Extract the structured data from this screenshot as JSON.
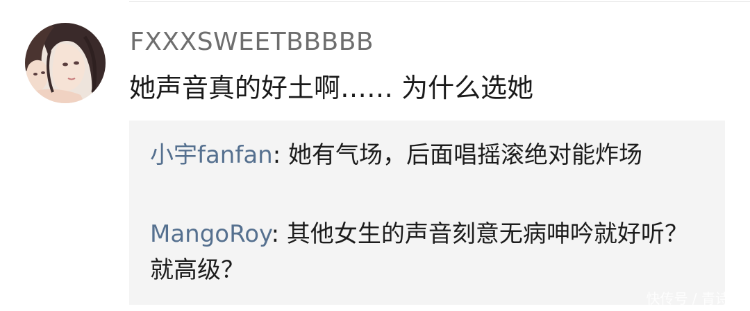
{
  "comment": {
    "avatar": {
      "icon": "anime-illustration-avatar"
    },
    "username": "FXXXSWEETBBBBB",
    "text": "她声音真的好土啊…… 为什么选她"
  },
  "replies": [
    {
      "author": "小宇fanfan",
      "separator": ": ",
      "text": "她有气场，后面唱摇滚绝对能炸场"
    },
    {
      "author": "MangoRoy",
      "separator": ": ",
      "text": "其他女生的声音刻意无病呻吟就好听？就高级？"
    }
  ],
  "watermark": "快传号 / 青诗"
}
